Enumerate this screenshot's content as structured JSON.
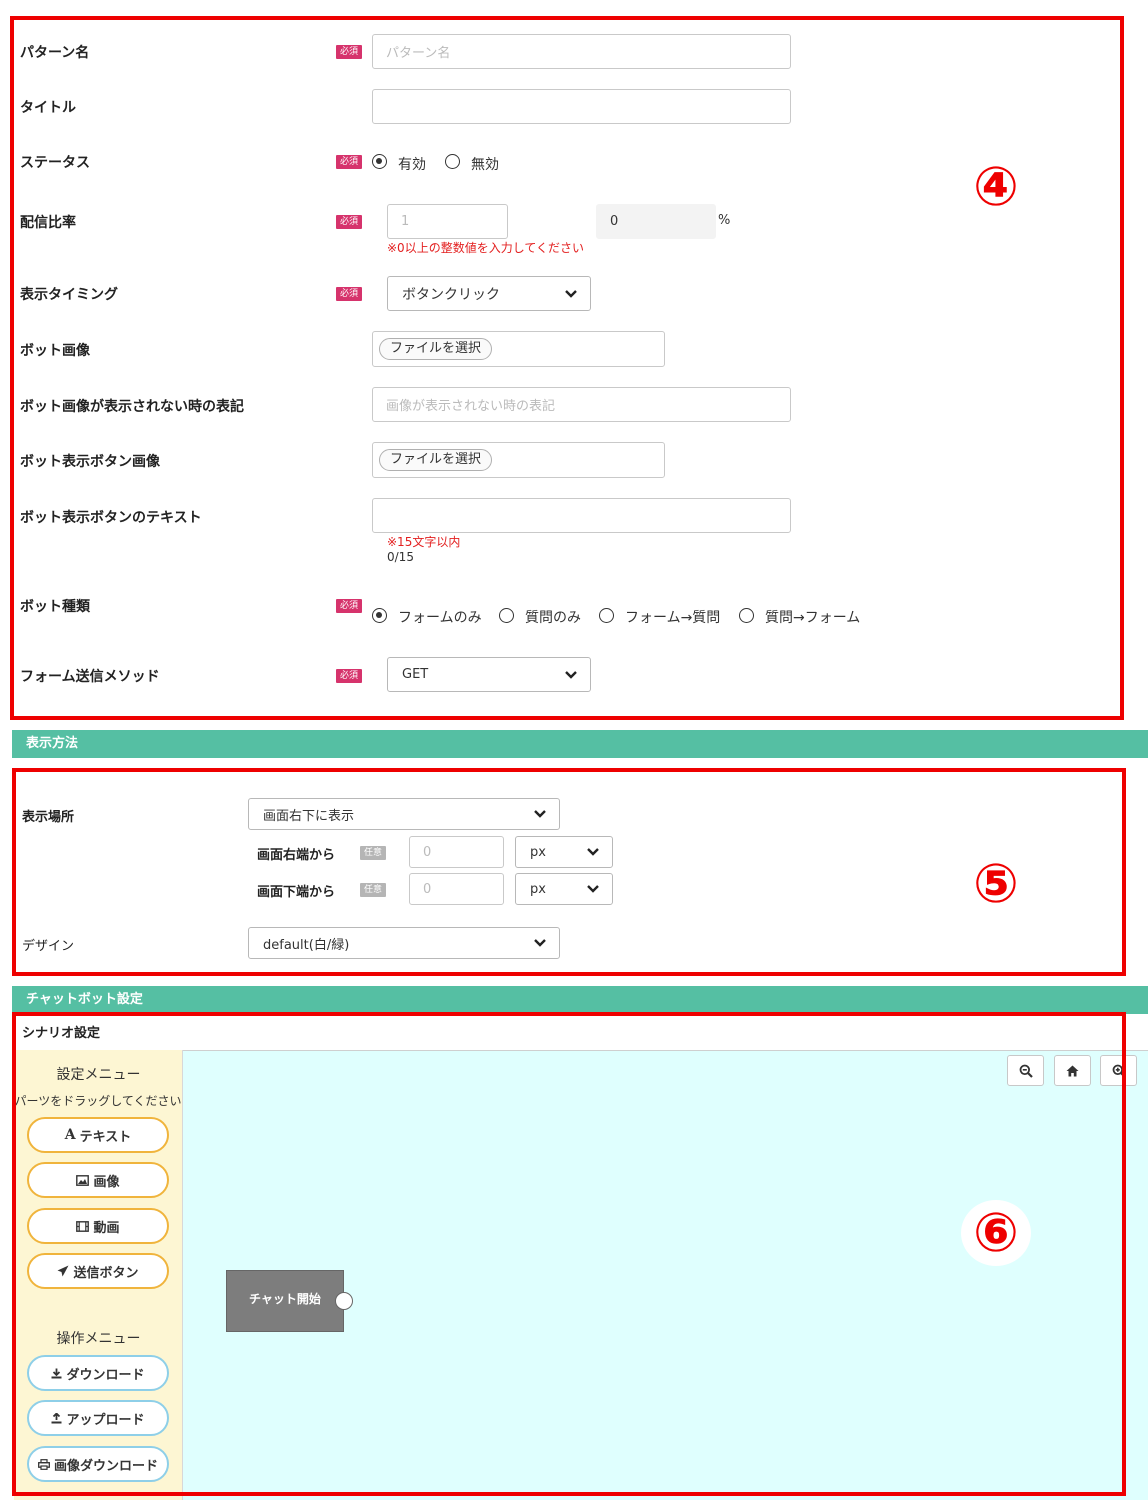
{
  "form": {
    "required_badge": "必須",
    "pattern_name": {
      "label": "パターン名",
      "placeholder": "パターン名"
    },
    "title": {
      "label": "タイトル",
      "value": ""
    },
    "status": {
      "label": "ステータス",
      "options": [
        "有効",
        "無効"
      ],
      "selected": "有効"
    },
    "distribution_ratio": {
      "label": "配信比率",
      "value_placeholder": "1",
      "computed": "0",
      "unit": "%",
      "hint": "※0以上の整数値を入力してください"
    },
    "display_timing": {
      "label": "表示タイミング",
      "selected": "ボタンクリック"
    },
    "bot_image": {
      "label": "ボット画像",
      "file_button": "ファイルを選択"
    },
    "bot_image_alt": {
      "label": "ボット画像が表示されない時の表記",
      "placeholder": "画像が表示されない時の表記"
    },
    "bot_button_image": {
      "label": "ボット表示ボタン画像",
      "file_button": "ファイルを選択"
    },
    "bot_button_text": {
      "label": "ボット表示ボタンのテキスト",
      "hint": "※15文字以内",
      "counter": "0/15"
    },
    "bot_type": {
      "label": "ボット種類",
      "options": [
        "フォームのみ",
        "質問のみ",
        "フォーム→質問",
        "質問→フォーム"
      ],
      "selected": "フォームのみ"
    },
    "form_method": {
      "label": "フォーム送信メソッド",
      "selected": "GET"
    }
  },
  "markers": {
    "m4": "④",
    "m5": "⑤",
    "m6": "⑥"
  },
  "display": {
    "section_title": "表示方法",
    "location": {
      "label": "表示場所",
      "selected": "画面右下に表示"
    },
    "optional_badge": "任意",
    "from_right": {
      "label": "画面右端から",
      "placeholder": "0",
      "unit": "px"
    },
    "from_bottom": {
      "label": "画面下端から",
      "placeholder": "0",
      "unit": "px"
    },
    "design": {
      "label": "デザイン",
      "selected": "default(白/緑)"
    }
  },
  "chatbot": {
    "section_title": "チャットボット設定",
    "scenario_title": "シナリオ設定",
    "settings_menu": {
      "title": "設定メニュー",
      "subtitle": "パーツをドラッグしてください",
      "text_btn": "テキスト",
      "image_btn": "画像",
      "video_btn": "動画",
      "send_btn": "送信ボタン"
    },
    "ops_menu": {
      "title": "操作メニュー",
      "download_btn": "ダウンロード",
      "upload_btn": "アップロード",
      "image_download_btn": "画像ダウンロード"
    },
    "start_node": "チャット開始"
  },
  "colors": {
    "accent_green": "#55bfa3",
    "required_badge": "#d6336c",
    "annotation_red": "#ee0000",
    "canvas_bg": "#dffffe",
    "palette_bg": "#fdf6d3"
  }
}
